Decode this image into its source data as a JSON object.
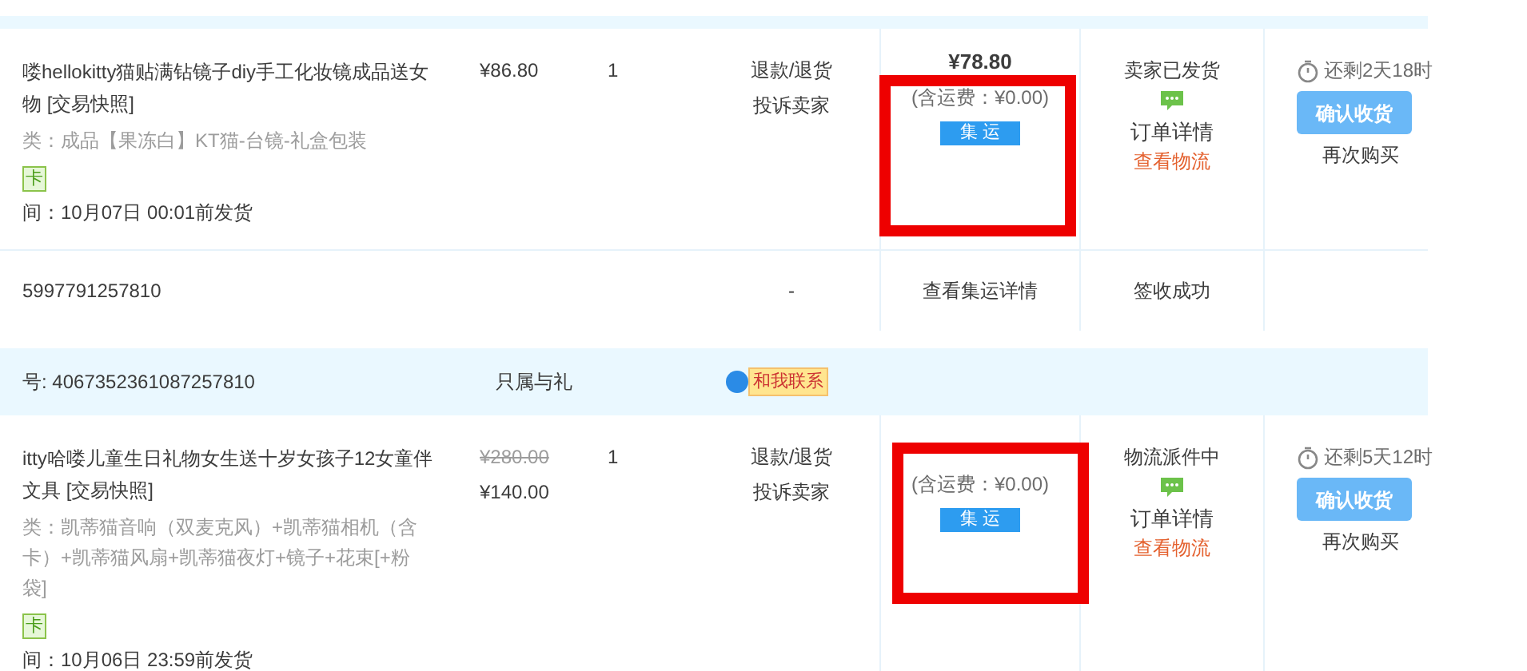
{
  "orders": [
    {
      "title_lines": [
        "喽hellokitty猫贴满钻镜子diy手工化妆镜成品送女",
        "物"
      ],
      "snapshot": "[交易快照]",
      "spec_lines": [
        "类：成品【果冻白】KT猫-台镜-礼盒包装"
      ],
      "card_badge": "卡",
      "ship_by": "间：10月07日 00:01前发货",
      "prices": [
        {
          "text": "¥86.80",
          "struck": false
        }
      ],
      "quantity": "1",
      "after_sale": [
        "退款/退货",
        "投诉卖家"
      ],
      "total": "¥78.80",
      "shipping": "(含运费：¥0.00)",
      "tag": "集 运",
      "highlighted": true,
      "status": "卖家已发货",
      "details": "订单详情",
      "logistics": "查看物流",
      "countdown": "还剩2天18时",
      "confirm": "确认收货",
      "rebuy": "再次购买",
      "sub_row": {
        "tracking": "5997791257810",
        "dash": "-",
        "consolidation": "查看集运详情",
        "result": "签收成功"
      }
    },
    {
      "header": {
        "order_no": "号: 4067352361087257810",
        "shop": "只属与礼",
        "contact": "和我联系"
      },
      "title_lines": [
        "itty哈喽儿童生日礼物女生送十岁女孩子12女童伴",
        "文具"
      ],
      "snapshot": "[交易快照]",
      "spec_lines": [
        "类：凯蒂猫音响（双麦克风）+凯蒂猫相机（含",
        "卡）+凯蒂猫风扇+凯蒂猫夜灯+镜子+花束[+粉",
        "袋]"
      ],
      "card_badge": "卡",
      "ship_by": "间：10月06日 23:59前发货",
      "prices": [
        {
          "text": "¥280.00",
          "struck": true
        },
        {
          "text": "¥140.00",
          "struck": false
        }
      ],
      "quantity": "1",
      "after_sale": [
        "退款/退货",
        "投诉卖家"
      ],
      "shipping": "(含运费：¥0.00)",
      "tag": "集 运",
      "highlighted": true,
      "status": "物流派件中",
      "details": "订单详情",
      "logistics": "查看物流",
      "countdown": "还剩5天12时",
      "confirm": "确认收货",
      "rebuy": "再次购买"
    }
  ]
}
